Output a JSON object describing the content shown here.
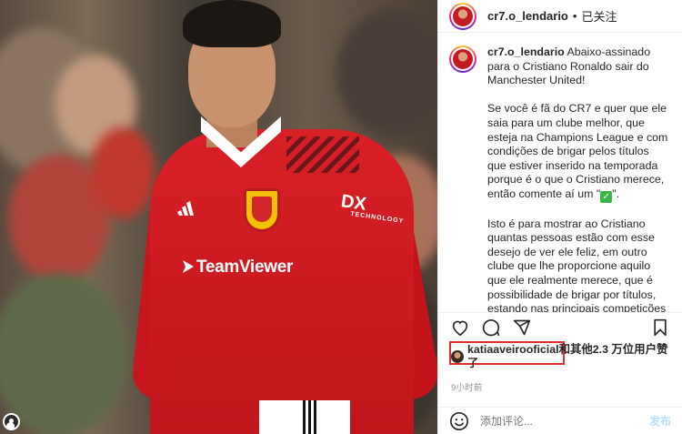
{
  "post": {
    "username": "cr7.o_lendario",
    "follow_status": "已关注",
    "separator": "•",
    "photo_sponsor": "TeamViewer",
    "photo_sleeve_logo": "DX",
    "photo_sleeve_sub": "TECHNOLOGY"
  },
  "caption": {
    "username": "cr7.o_lendario",
    "paragraph1": "Abaixo-assinado para o Cristiano Ronaldo sair do Manchester United!",
    "paragraph2": "Se você é fã do CR7 e quer que ele saia para um clube melhor, que esteja na Champions League e com condições de brigar pelos títulos que estiver inserido na temporada porque é o que o Cristiano merece, então comente aí um \"",
    "paragraph2_end": "\".",
    "check_glyph": "✓",
    "paragraph3": "Isto é para mostrar ao Cristiano quantas pessoas estão com esse desejo de ver ele feliz, em outro clube que lhe proporcione aquilo que ele realmente merece, que é possibilidade de brigar por títulos, estando nas principais competições"
  },
  "actions": {
    "icons": [
      "heart-icon",
      "comment-icon",
      "share-icon",
      "bookmark-icon"
    ]
  },
  "likes": {
    "user": "katiaaveirooficial",
    "rest": "和其他2.3 万位用户赞了"
  },
  "timestamp": "9小时前",
  "comment": {
    "placeholder": "添加评论...",
    "post_label": "发布"
  },
  "colors": {
    "accent_highlight": "#e32b2b",
    "link_blue": "#b2dffc",
    "shirt_red": "#d81f26"
  }
}
